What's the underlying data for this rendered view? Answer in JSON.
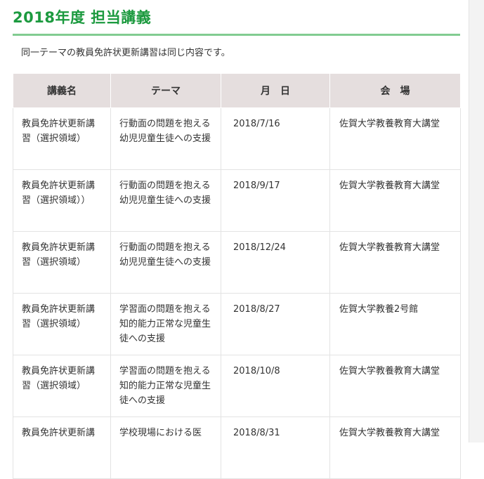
{
  "page": {
    "title": "2018年度 担当講義",
    "note": "同一テーマの教員免許状更新講習は同じ内容です。"
  },
  "table": {
    "headers": [
      "講義名",
      "テーマ",
      "月　日",
      "会　場"
    ],
    "rows": [
      {
        "course_name": "教員免許状更新講習（選択領域）",
        "theme": "行動面の問題を抱える幼児児童生徒への支援",
        "date": "2018/7/16",
        "venue": "佐賀大学教養教育大講堂"
      },
      {
        "course_name": "教員免許状更新講習（選択領域））",
        "theme": "行動面の問題を抱える幼児児童生徒への支援",
        "date": "2018/9/17",
        "venue": "佐賀大学教養教育大講堂"
      },
      {
        "course_name": "教員免許状更新講習（選択領域）",
        "theme": "行動面の問題を抱える幼児児童生徒への支援",
        "date": "2018/12/24",
        "venue": "佐賀大学教養教育大講堂"
      },
      {
        "course_name": "教員免許状更新講習（選択領域）",
        "theme": "学習面の問題を抱える知的能力正常な児童生徒への支援",
        "date": "2018/8/27",
        "venue": "佐賀大学教養2号館"
      },
      {
        "course_name": "教員免許状更新講習（選択領域）",
        "theme": "学習面の問題を抱える知的能力正常な児童生徒への支援",
        "date": "2018/10/8",
        "venue": "佐賀大学教養教育大講堂"
      },
      {
        "course_name": "教員免許状更新講",
        "theme": "学校現場における医",
        "date": "2018/8/31",
        "venue": "佐賀大学教養教育大講堂"
      }
    ]
  }
}
